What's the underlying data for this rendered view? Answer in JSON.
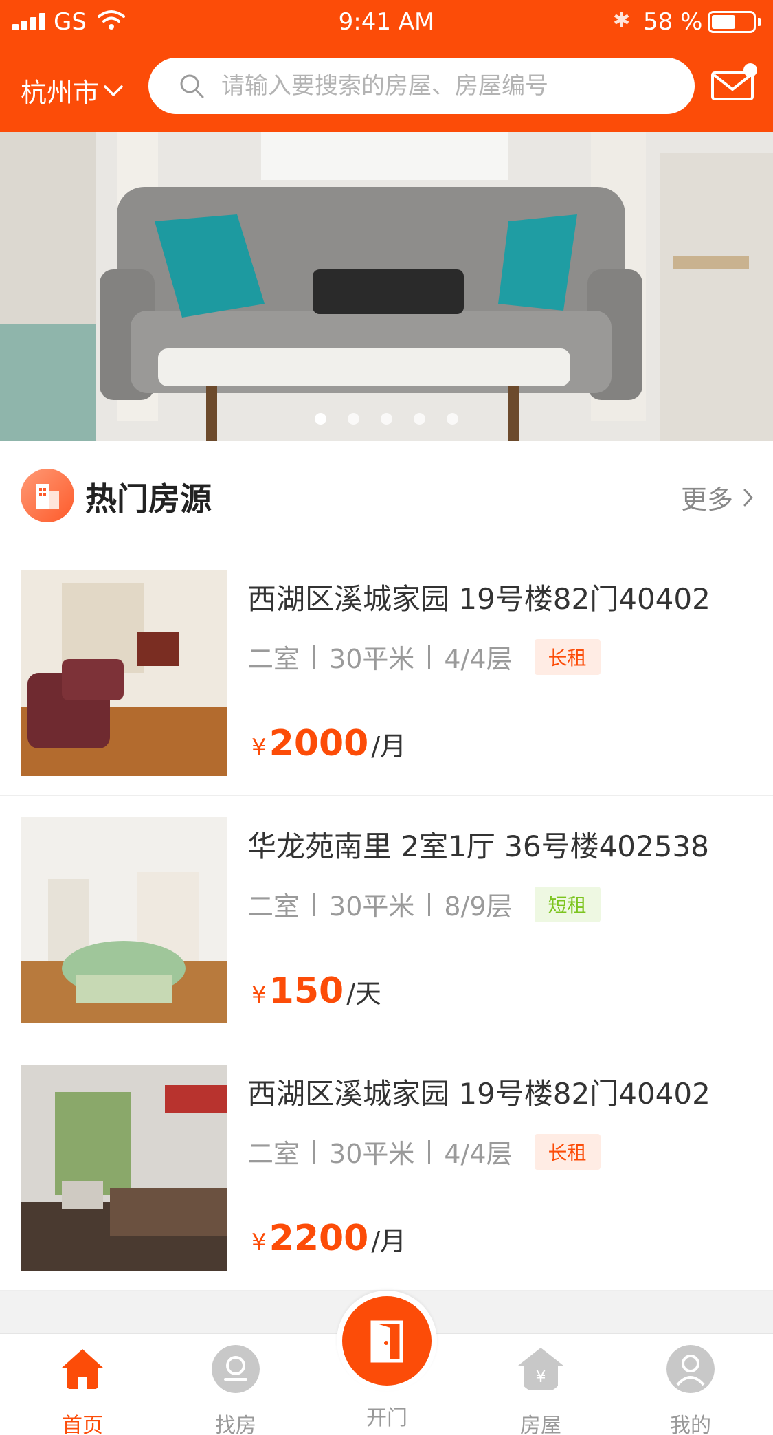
{
  "status_bar": {
    "carrier": "GS",
    "time": "9:41 AM",
    "battery": "58 %",
    "battery_level": 0.58
  },
  "header": {
    "city": "杭州市",
    "search_placeholder": "请输入要搜索的房屋、房屋编号"
  },
  "banner": {
    "slides": 5,
    "active_slide": 1
  },
  "section": {
    "title": "热门房源",
    "more": "更多"
  },
  "listings": [
    {
      "title": "西湖区溪城家园 19号楼82门40402",
      "rooms": "二室",
      "area": "30平米",
      "floor": "4/4层",
      "tag": "长租",
      "tag_color": "#fc4c08",
      "tag_bg": "#ffece4",
      "currency": "¥",
      "price": "2000",
      "unit": "/月"
    },
    {
      "title": "华龙苑南里 2室1厅 36号楼402538",
      "rooms": "二室",
      "area": "30平米",
      "floor": "8/9层",
      "tag": "短租",
      "tag_color": "#7cc41f",
      "tag_bg": "#eef8e2",
      "currency": "¥",
      "price": "150",
      "unit": "/天"
    },
    {
      "title": "西湖区溪城家园 19号楼82门40402",
      "rooms": "二室",
      "area": "30平米",
      "floor": "4/4层",
      "tag": "长租",
      "tag_color": "#fc4c08",
      "tag_bg": "#ffece4",
      "currency": "¥",
      "price": "2200",
      "unit": "/月"
    }
  ],
  "tabbar": {
    "home": "首页",
    "find": "找房",
    "open": "开门",
    "houses": "房屋",
    "mine": "我的"
  },
  "colors": {
    "accent": "#fc4c08",
    "inactive": "#c8c8c8"
  }
}
